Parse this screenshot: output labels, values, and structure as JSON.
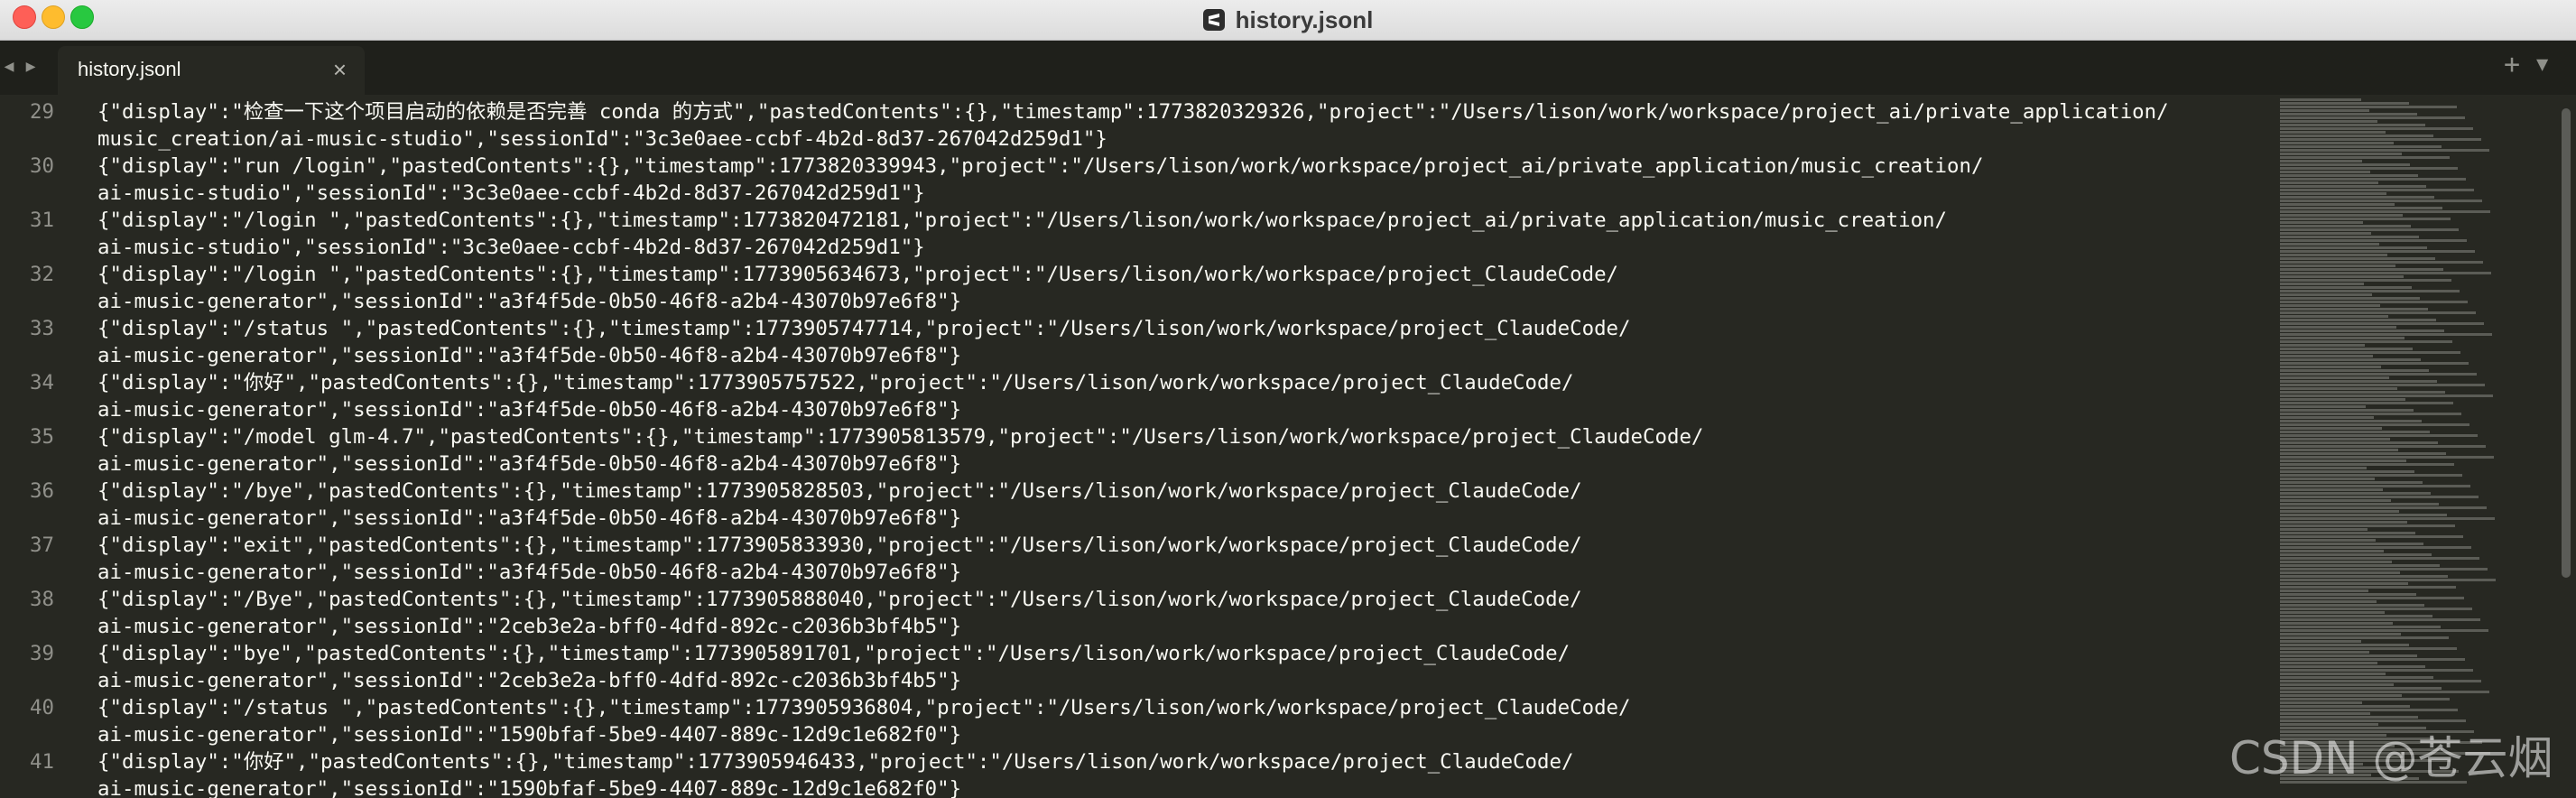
{
  "window": {
    "title": "history.jsonl",
    "icon": "sublime-text-icon"
  },
  "tabs": {
    "active_label": "history.jsonl",
    "close_glyph": "×",
    "add_glyph": "+",
    "menu_glyph": "▼",
    "back_glyph": "◀",
    "forward_glyph": "▶"
  },
  "lines": [
    {
      "n": "29",
      "a": "{\"display\":\"检查一下这个项目启动的依赖是否完善 conda 的方式\",\"pastedContents\":{},\"timestamp\":1773820329326,\"project\":\"/Users/lison/work/workspace/project_ai/private_application/",
      "b": "music_creation/ai-music-studio\",\"sessionId\":\"3c3e0aee-ccbf-4b2d-8d37-267042d259d1\"}"
    },
    {
      "n": "30",
      "a": "{\"display\":\"run /login\",\"pastedContents\":{},\"timestamp\":1773820339943,\"project\":\"/Users/lison/work/workspace/project_ai/private_application/music_creation/",
      "b": "ai-music-studio\",\"sessionId\":\"3c3e0aee-ccbf-4b2d-8d37-267042d259d1\"}"
    },
    {
      "n": "31",
      "a": "{\"display\":\"/login \",\"pastedContents\":{},\"timestamp\":1773820472181,\"project\":\"/Users/lison/work/workspace/project_ai/private_application/music_creation/",
      "b": "ai-music-studio\",\"sessionId\":\"3c3e0aee-ccbf-4b2d-8d37-267042d259d1\"}"
    },
    {
      "n": "32",
      "a": "{\"display\":\"/login \",\"pastedContents\":{},\"timestamp\":1773905634673,\"project\":\"/Users/lison/work/workspace/project_ClaudeCode/",
      "b": "ai-music-generator\",\"sessionId\":\"a3f4f5de-0b50-46f8-a2b4-43070b97e6f8\"}"
    },
    {
      "n": "33",
      "a": "{\"display\":\"/status \",\"pastedContents\":{},\"timestamp\":1773905747714,\"project\":\"/Users/lison/work/workspace/project_ClaudeCode/",
      "b": "ai-music-generator\",\"sessionId\":\"a3f4f5de-0b50-46f8-a2b4-43070b97e6f8\"}"
    },
    {
      "n": "34",
      "a": "{\"display\":\"你好\",\"pastedContents\":{},\"timestamp\":1773905757522,\"project\":\"/Users/lison/work/workspace/project_ClaudeCode/",
      "b": "ai-music-generator\",\"sessionId\":\"a3f4f5de-0b50-46f8-a2b4-43070b97e6f8\"}"
    },
    {
      "n": "35",
      "a": "{\"display\":\"/model glm-4.7\",\"pastedContents\":{},\"timestamp\":1773905813579,\"project\":\"/Users/lison/work/workspace/project_ClaudeCode/",
      "b": "ai-music-generator\",\"sessionId\":\"a3f4f5de-0b50-46f8-a2b4-43070b97e6f8\"}"
    },
    {
      "n": "36",
      "a": "{\"display\":\"/bye\",\"pastedContents\":{},\"timestamp\":1773905828503,\"project\":\"/Users/lison/work/workspace/project_ClaudeCode/",
      "b": "ai-music-generator\",\"sessionId\":\"a3f4f5de-0b50-46f8-a2b4-43070b97e6f8\"}"
    },
    {
      "n": "37",
      "a": "{\"display\":\"exit\",\"pastedContents\":{},\"timestamp\":1773905833930,\"project\":\"/Users/lison/work/workspace/project_ClaudeCode/",
      "b": "ai-music-generator\",\"sessionId\":\"a3f4f5de-0b50-46f8-a2b4-43070b97e6f8\"}"
    },
    {
      "n": "38",
      "a": "{\"display\":\"/Bye\",\"pastedContents\":{},\"timestamp\":1773905888040,\"project\":\"/Users/lison/work/workspace/project_ClaudeCode/",
      "b": "ai-music-generator\",\"sessionId\":\"2ceb3e2a-bff0-4dfd-892c-c2036b3bf4b5\"}"
    },
    {
      "n": "39",
      "a": "{\"display\":\"bye\",\"pastedContents\":{},\"timestamp\":1773905891701,\"project\":\"/Users/lison/work/workspace/project_ClaudeCode/",
      "b": "ai-music-generator\",\"sessionId\":\"2ceb3e2a-bff0-4dfd-892c-c2036b3bf4b5\"}"
    },
    {
      "n": "40",
      "a": "{\"display\":\"/status \",\"pastedContents\":{},\"timestamp\":1773905936804,\"project\":\"/Users/lison/work/workspace/project_ClaudeCode/",
      "b": "ai-music-generator\",\"sessionId\":\"1590bfaf-5be9-4407-889c-12d9c1e682f0\"}"
    },
    {
      "n": "41",
      "a": "{\"display\":\"你好\",\"pastedContents\":{},\"timestamp\":1773905946433,\"project\":\"/Users/lison/work/workspace/project_ClaudeCode/",
      "b": "ai-music-generator\",\"sessionId\":\"1590bfaf-5be9-4407-889c-12d9c1e682f0\"}"
    }
  ],
  "watermark": "CSDN @苍云烟",
  "colors": {
    "editor_bg": "#272822",
    "text": "#f8f8f2",
    "gutter": "#90908a",
    "tabbar_bg": "#1f201b"
  }
}
